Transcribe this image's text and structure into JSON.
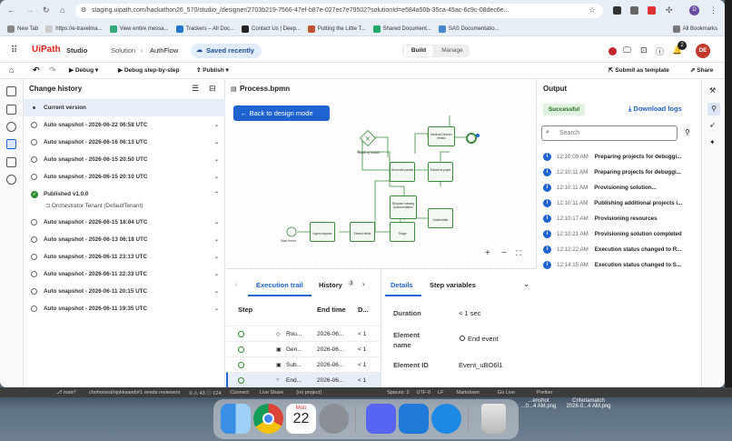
{
  "browser": {
    "url": "staging.uipath.com/hackathon26_570/studio_/designer/2703b219-7566-47ef-b87e-027ec7e79502?solutionId=e584a50b-35ca-45ac-6c9c-08dec6e...",
    "bookmarks": [
      "New Tab",
      "https://e-travelma...",
      "View entire messa...",
      "Trackers – All Doc...",
      "Contact Us | Deep...",
      "Putting the Little T...",
      "Shared Document...",
      "SAS Documentatio..."
    ],
    "all_bookmarks": "All Bookmarks",
    "profile": "D"
  },
  "app": {
    "brand": "UiPath",
    "product": "Studio",
    "breadcrumb_solution": "Solution",
    "breadcrumb_sep": "›",
    "breadcrumb_project": "AuthFlow",
    "saved_status": "Saved recently",
    "mode_build": "Build",
    "mode_manage": "Manage",
    "notif_count": "2",
    "avatar": "DE"
  },
  "toolbar": {
    "debug": "Debug",
    "debug_step": "Debug step-by-step",
    "publish": "Publish",
    "submit_template": "Submit as template",
    "share": "Share"
  },
  "history": {
    "title": "Change history",
    "current": "Current version",
    "items": [
      {
        "label": "Auto snapshot - 2026-06-22 06:58 UTC"
      },
      {
        "label": "Auto snapshot - 2026-06-16 06:13 UTC"
      },
      {
        "label": "Auto snapshot - 2026-06-15 20:50 UTC"
      },
      {
        "label": "Auto snapshot - 2026-06-15 20:10 UTC"
      },
      {
        "label": "Published v1.0.0"
      },
      {
        "label": "Auto snapshot - 2026-06-15 18:04 UTC"
      },
      {
        "label": "Auto snapshot - 2026-06-13 06:18 UTC"
      },
      {
        "label": "Auto snapshot - 2026-06-11 23:13 UTC"
      },
      {
        "label": "Auto snapshot - 2026-06-11 22:33 UTC"
      },
      {
        "label": "Auto snapshot - 2026-06-11 20:15 UTC"
      },
      {
        "label": "Auto snapshot - 2026-06-11 19:35 UTC"
      }
    ],
    "published_sub": "Orchestrator Tenant (DefaultTenant)"
  },
  "canvas": {
    "file": "Process.bpmn",
    "back_button": "Back to design mode",
    "nodes": {
      "route": "Route by branch",
      "medical": "Medical Director review",
      "generate": "Generate packet",
      "submit": "Submit to payer",
      "request": "Request missing documentation",
      "underwriter": "Underwriter",
      "ingest": "Ingest request",
      "extract": "Extract fields",
      "triage": "Triage",
      "start": "Start event"
    },
    "zoom_in": "+",
    "zoom_out": "−"
  },
  "trail": {
    "tab_exec": "Execution trail",
    "tab_history": "History",
    "history_badge": "3",
    "col_step": "Step",
    "col_end": "End time",
    "col_d": "D...",
    "rows": [
      {
        "step": "Rou...",
        "end": "2026-06...",
        "d": "< 1"
      },
      {
        "step": "Gen...",
        "end": "2026-06...",
        "d": "< 1"
      },
      {
        "step": "Sub...",
        "end": "2026-06...",
        "d": "< 1"
      },
      {
        "step": "End...",
        "end": "2026-06...",
        "d": "< 1"
      }
    ]
  },
  "details": {
    "tab_details": "Details",
    "tab_vars": "Step variables",
    "duration_label": "Duration",
    "duration_value": "< 1 sec",
    "element_name_label": "Element name",
    "element_name_value": "End event",
    "element_id_label": "Element ID",
    "element_id_value": "Event_uBO6l1"
  },
  "output": {
    "title": "Output",
    "status": "Successful",
    "download": "Download logs",
    "search_placeholder": "Search",
    "rows": [
      {
        "time": "12:10:09 AM",
        "msg": "Preparing projects for debuggi..."
      },
      {
        "time": "12:10:11 AM",
        "msg": "Preparing projects for debuggi..."
      },
      {
        "time": "12:10:11 AM",
        "msg": "Provisioning solution..."
      },
      {
        "time": "12:10:11 AM",
        "msg": "Publishing additional projects i..."
      },
      {
        "time": "12:10:17 AM",
        "msg": "Provisioning resources"
      },
      {
        "time": "12:10:21 AM",
        "msg": "Provisioning solution completed"
      },
      {
        "time": "12:12:22 AM",
        "msg": "Execution status changed to R..."
      },
      {
        "time": "12:14:15 AM",
        "msg": "Execution status changed to S..."
      }
    ]
  },
  "statusbar": {
    "branch": "main*",
    "reviewers": "chohonest/njokkaweb#1 needs reviewers",
    "problems": "0 ⚠ 43 ⓘ 124",
    "connect": "Connect",
    "liveshare": "Live Share",
    "project": "(no project)",
    "spaces": "Spaces: 2",
    "encoding": "UTF-8",
    "eol": "LF",
    "lang": "Markdown",
    "golive": "Go Live",
    "prettier": "Prettier"
  },
  "desktop": {
    "file1": "Criteriamatch",
    "file1_sub": "2026-0...4 AM.png",
    "file2": "...enshot",
    "file2_sub": "...0...4 AM.png"
  },
  "dock": {
    "calendar_month": "Mon",
    "calendar_day": "22"
  },
  "colors": {
    "accent": "#1f63d0",
    "success": "#2e8b2e",
    "brand_red": "#e2231a"
  }
}
